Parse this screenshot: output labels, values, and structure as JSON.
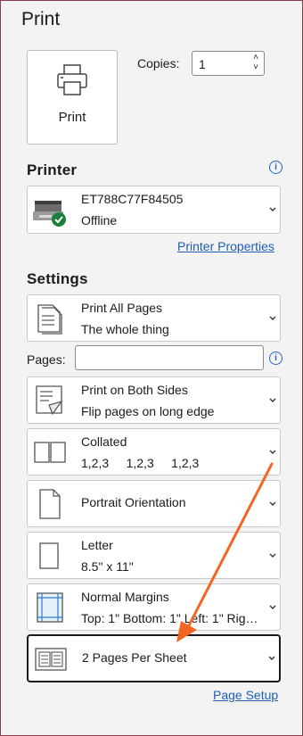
{
  "title": "Print",
  "print_button_label": "Print",
  "copies": {
    "label": "Copies:",
    "value": "1"
  },
  "printer": {
    "section_label": "Printer",
    "name": "ET788C77F84505",
    "status": "Offline",
    "properties_link": "Printer Properties"
  },
  "settings": {
    "section_label": "Settings",
    "pages_label": "Pages:",
    "pages_value": "",
    "items": [
      {
        "line1": "Print All Pages",
        "line2": "The whole thing",
        "icon": "document-pages-icon"
      },
      {
        "line1": "Print on Both Sides",
        "line2": "Flip pages on long edge",
        "icon": "duplex-icon"
      },
      {
        "line1": "Collated",
        "line2": "1,2,3     1,2,3     1,2,3",
        "icon": "collated-icon"
      },
      {
        "line1": "Portrait Orientation",
        "line2": "",
        "icon": "portrait-icon"
      },
      {
        "line1": "Letter",
        "line2": "8.5\" x 11\"",
        "icon": "letter-size-icon"
      },
      {
        "line1": "Normal Margins",
        "line2": "Top: 1\" Bottom: 1\" Left: 1\" Rig…",
        "icon": "margins-icon"
      },
      {
        "line1": "2 Pages Per Sheet",
        "line2": "",
        "icon": "pages-per-sheet-icon"
      }
    ],
    "page_setup_link": "Page Setup"
  },
  "annotation": {
    "color": "#f26522"
  }
}
